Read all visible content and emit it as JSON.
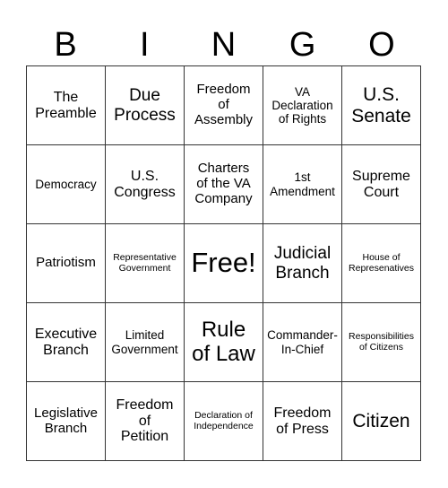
{
  "header": {
    "letters": [
      "B",
      "I",
      "N",
      "G",
      "O"
    ]
  },
  "cells": [
    [
      "The\nPreamble",
      "Due\nProcess",
      "Freedom\nof\nAssembly",
      "VA\nDeclaration\nof Rights",
      "U.S.\nSenate"
    ],
    [
      "Democracy",
      "U.S.\nCongress",
      "Charters\nof the VA\nCompany",
      "1st\nAmendment",
      "Supreme\nCourt"
    ],
    [
      "Patriotism",
      "Representative\nGovernment",
      "Free!",
      "Judicial\nBranch",
      "House of\nRepresenatives"
    ],
    [
      "Executive\nBranch",
      "Limited\nGovernment",
      "Rule\nof Law",
      "Commander-\nIn-Chief",
      "Responsibilities\nof Citizens"
    ],
    [
      "Legislative\nBranch",
      "Freedom\nof\nPetition",
      "Declaration of\nIndependence",
      "Freedom\nof Press",
      "Citizen"
    ]
  ]
}
